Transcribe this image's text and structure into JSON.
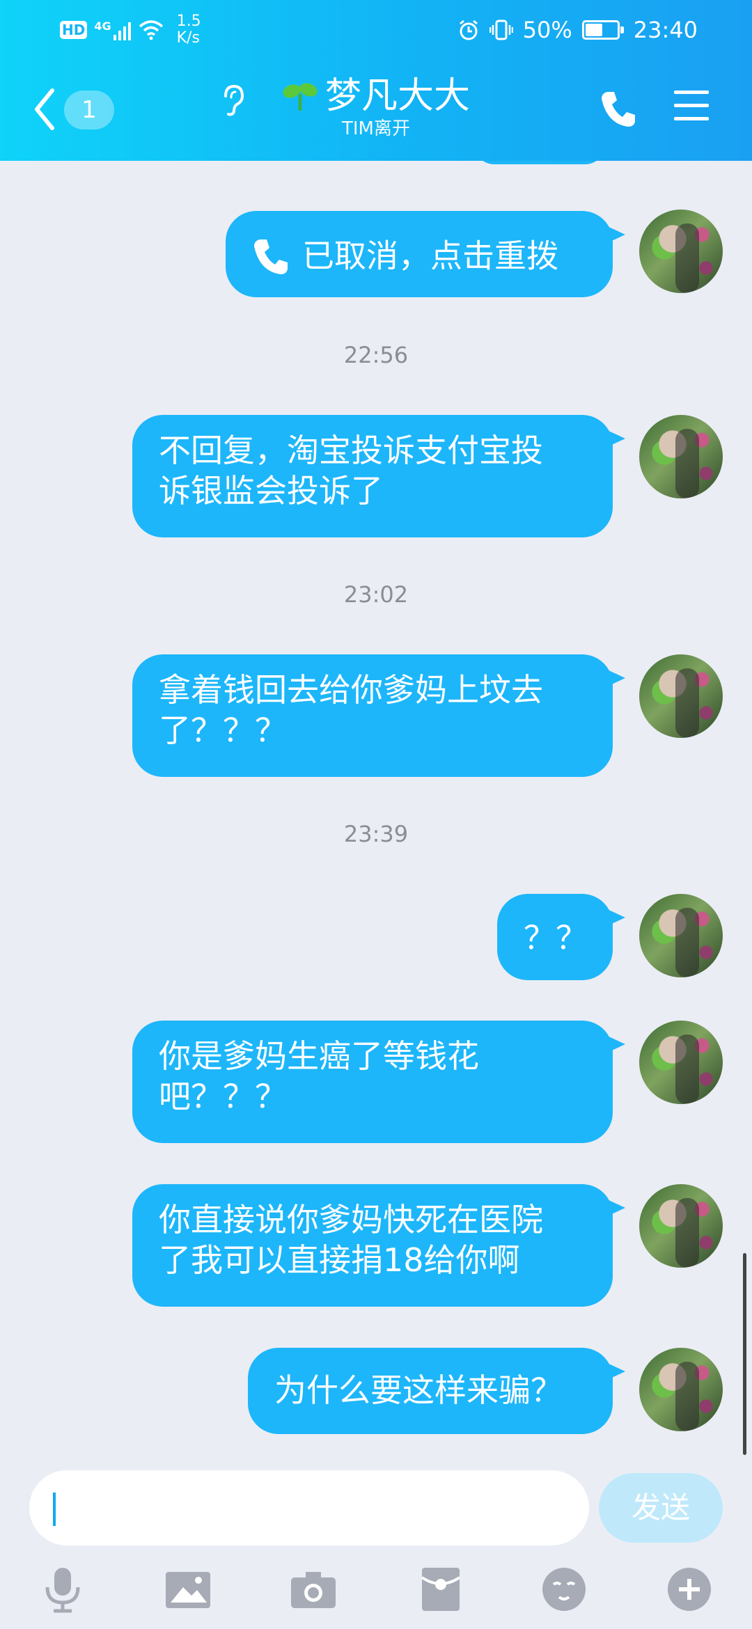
{
  "status_bar": {
    "hd": "HD",
    "network": "4G",
    "speed_value": "1.5",
    "speed_unit": "K/s",
    "battery": "50%",
    "time": "23:40"
  },
  "header": {
    "unread_count": "1",
    "contact_name": "梦凡大大",
    "status": "TIM离开"
  },
  "messages": [
    {
      "type": "call",
      "text": "已取消，点击重拨"
    },
    {
      "type": "time",
      "text": "22:56"
    },
    {
      "type": "text",
      "lines": [
        "不回复，淘宝投诉支付宝投",
        "诉银监会投诉了"
      ]
    },
    {
      "type": "time",
      "text": "23:02"
    },
    {
      "type": "text",
      "lines": [
        "拿着钱回去给你爹妈上坟去",
        "了？？？"
      ]
    },
    {
      "type": "time",
      "text": "23:39"
    },
    {
      "type": "text",
      "lines": [
        "？？"
      ]
    },
    {
      "type": "text",
      "lines": [
        "你是爹妈生癌了等钱花",
        "吧？？？"
      ]
    },
    {
      "type": "text",
      "lines": [
        "你直接说你爹妈快死在医院",
        "了我可以直接捐18给你啊"
      ]
    },
    {
      "type": "text",
      "lines": [
        "为什么要这样来骗？"
      ]
    }
  ],
  "input": {
    "value": "",
    "send_label": "发送"
  },
  "toolbar": [
    "mic-icon",
    "image-icon",
    "camera-icon",
    "red-packet-icon",
    "emoji-icon",
    "plus-icon"
  ],
  "colors": {
    "header_start": "#0fd3f9",
    "header_end": "#1aa0f2",
    "bubble": "#1db6fa",
    "background": "#ebedf5",
    "send_disabled": "#bfe9fb"
  }
}
